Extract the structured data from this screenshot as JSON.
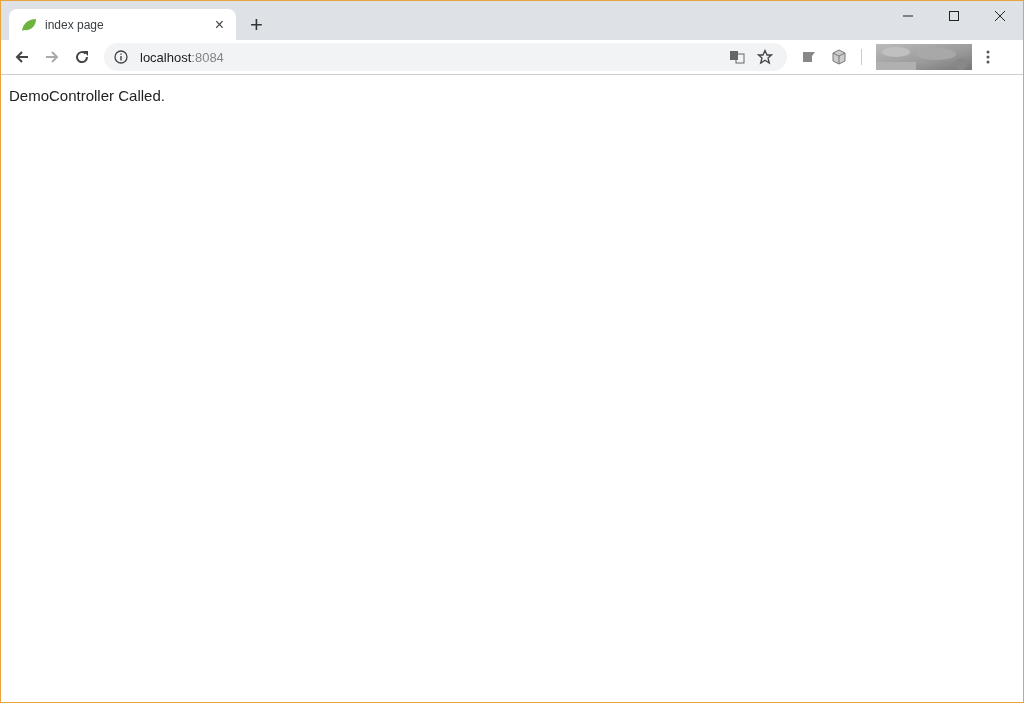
{
  "tabs": [
    {
      "title": "index page",
      "selected": true,
      "close": "×"
    }
  ],
  "new_tab": "+",
  "address": {
    "host": "localhost",
    "port": ":8084"
  },
  "page": {
    "text": "DemoController Called."
  }
}
